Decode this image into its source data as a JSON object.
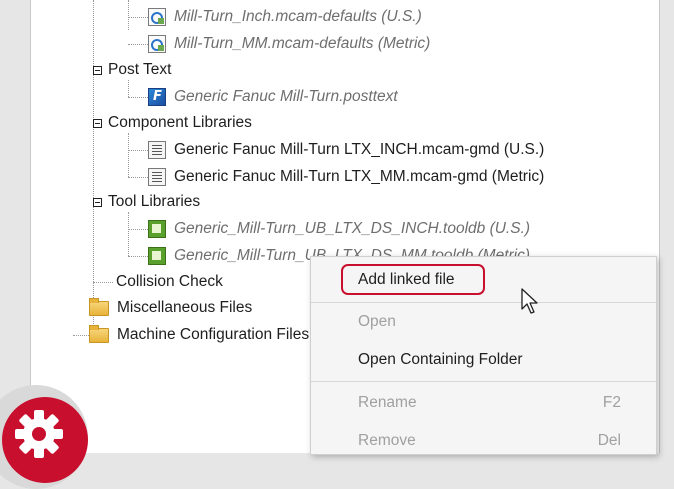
{
  "tree": {
    "items": [
      {
        "label": "Mill-Turn_Inch.mcam-defaults (U.S.)",
        "italic": true,
        "icon": "defaults-file-icon"
      },
      {
        "label": "Mill-Turn_MM.mcam-defaults (Metric)",
        "italic": true,
        "icon": "defaults-file-icon"
      },
      {
        "label": "Post Text",
        "italic": false,
        "icon": "collapse-toggle"
      },
      {
        "label": "Generic Fanuc Mill-Turn.posttext",
        "italic": true,
        "icon": "post-file-icon"
      },
      {
        "label": "Component Libraries",
        "italic": false,
        "icon": "collapse-toggle"
      },
      {
        "label": "Generic Fanuc Mill-Turn LTX_INCH.mcam-gmd (U.S.)",
        "italic": false,
        "icon": "gmd-file-icon"
      },
      {
        "label": "Generic Fanuc Mill-Turn LTX_MM.mcam-gmd (Metric)",
        "italic": false,
        "icon": "gmd-file-icon"
      },
      {
        "label": "Tool Libraries",
        "italic": false,
        "icon": "collapse-toggle"
      },
      {
        "label": "Generic_Mill-Turn_UB_LTX_DS_INCH.tooldb (U.S.)",
        "italic": true,
        "icon": "tooldb-file-icon"
      },
      {
        "label": "Generic_Mill-Turn_UB_LTX_DS_MM.tooldb (Metric)",
        "italic": true,
        "icon": "tooldb-file-icon"
      },
      {
        "label": "Collision Check",
        "italic": false,
        "icon": "none"
      },
      {
        "label": "Miscellaneous Files",
        "italic": false,
        "icon": "folder-icon"
      },
      {
        "label": "Machine Configuration Files",
        "italic": false,
        "icon": "folder-icon"
      }
    ]
  },
  "context_menu": {
    "add_linked_file": "Add linked file",
    "open": "Open",
    "open_containing_folder": "Open Containing Folder",
    "rename": "Rename",
    "rename_shortcut": "F2",
    "remove": "Remove",
    "remove_shortcut": "Del"
  },
  "colors": {
    "highlight": "#c8102e",
    "badge": "#c8102e"
  },
  "icons": {
    "badge": "gear-icon",
    "pointer": "mouse-cursor-icon"
  }
}
